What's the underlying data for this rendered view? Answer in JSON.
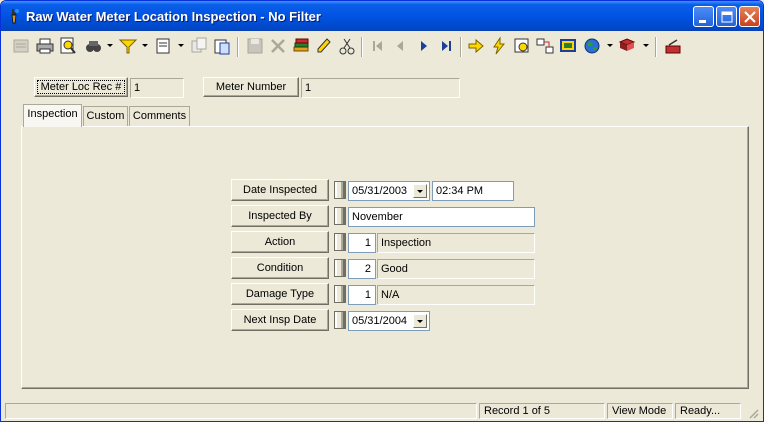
{
  "window": {
    "title": "Raw Water Meter Location Inspection - No Filter"
  },
  "header": {
    "meter_loc_label": "Meter Loc Rec #",
    "meter_loc_value": "1",
    "meter_number_label": "Meter Number",
    "meter_number_value": "1"
  },
  "tabs": [
    {
      "label": "Inspection"
    },
    {
      "label": "Custom"
    },
    {
      "label": "Comments"
    }
  ],
  "form": {
    "date_inspected": {
      "label": "Date Inspected",
      "date": "05/31/2003",
      "time": "02:34 PM"
    },
    "inspected_by": {
      "label": "Inspected By",
      "value": "November"
    },
    "action": {
      "label": "Action",
      "code": "1",
      "value": "Inspection"
    },
    "condition": {
      "label": "Condition",
      "code": "2",
      "value": "Good"
    },
    "damage_type": {
      "label": "Damage Type",
      "code": "1",
      "value": "N/A"
    },
    "next_insp_date": {
      "label": "Next Insp Date",
      "date": "05/31/2004"
    }
  },
  "status": {
    "record": "Record 1 of 5",
    "mode": "View Mode",
    "state": "Ready..."
  },
  "colors": {
    "titlebar": "#0054e3",
    "face": "#ece9d8"
  },
  "icons": [
    "app-icon",
    "new-record-icon",
    "print-icon",
    "print-preview-icon",
    "find-icon",
    "filter-icon",
    "report-icon",
    "copy-icon",
    "paste-icon",
    "save-icon",
    "delete-icon",
    "layers-icon",
    "edit-icon",
    "cut-icon",
    "first-record-icon",
    "prev-record-icon",
    "next-record-icon",
    "last-record-icon",
    "goto-icon",
    "lightning-icon",
    "zoom-icon",
    "link-icon",
    "chart-icon",
    "globe-icon",
    "book-icon",
    "exit-icon",
    "minimize-icon",
    "maximize-icon",
    "close-icon"
  ]
}
